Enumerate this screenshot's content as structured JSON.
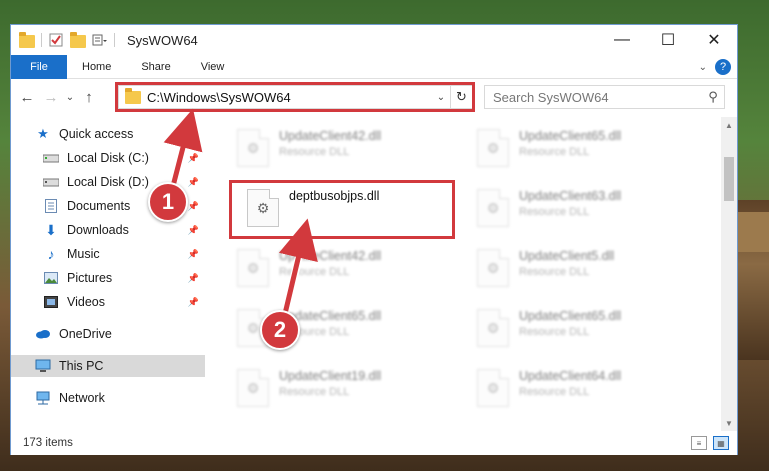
{
  "window": {
    "title": "SysWOW64"
  },
  "window_controls": {
    "minimize": "—",
    "maximize": "☐",
    "close": "✕"
  },
  "ribbon": {
    "tabs": [
      "File",
      "Home",
      "Share",
      "View"
    ],
    "help": "?"
  },
  "nav": {
    "back": "←",
    "forward": "→",
    "recent": "⌄",
    "up": "↑"
  },
  "address": {
    "path": "C:\\Windows\\SysWOW64",
    "dropdown": "⌄",
    "refresh": "↻"
  },
  "search": {
    "placeholder": "Search SysWOW64"
  },
  "sidebar": {
    "items": [
      {
        "label": "Quick access",
        "icon": "star-icon"
      },
      {
        "label": "Local Disk (C:)",
        "icon": "drive-icon",
        "pinned": true
      },
      {
        "label": "Local Disk (D:)",
        "icon": "drive-icon",
        "pinned": true
      },
      {
        "label": "Documents",
        "icon": "document-icon",
        "pinned": true
      },
      {
        "label": "Downloads",
        "icon": "download-icon",
        "pinned": true
      },
      {
        "label": "Music",
        "icon": "music-icon",
        "pinned": true
      },
      {
        "label": "Pictures",
        "icon": "picture-icon",
        "pinned": true
      },
      {
        "label": "Videos",
        "icon": "video-icon",
        "pinned": true
      },
      {
        "label": "OneDrive",
        "icon": "cloud-icon"
      },
      {
        "label": "This PC",
        "icon": "computer-icon",
        "selected": true
      },
      {
        "label": "Network",
        "icon": "network-icon"
      }
    ]
  },
  "files": [
    {
      "name": "UpdateClient42.dll",
      "type": "Resource DLL",
      "blurred": true
    },
    {
      "name": "UpdateClient65.dll",
      "type": "Resource DLL",
      "blurred": true
    },
    {
      "name": "deptbusobjps.dll",
      "type": "",
      "blurred": false
    },
    {
      "name": "UpdateClient63.dll",
      "type": "Resource DLL",
      "blurred": true
    },
    {
      "name": "UpdateClient42.dll",
      "type": "Resource DLL",
      "blurred": true
    },
    {
      "name": "UpdateClient5.dll",
      "type": "Resource DLL",
      "blurred": true
    },
    {
      "name": "UpdateClient65.dll",
      "type": "Resource DLL",
      "blurred": true
    },
    {
      "name": "UpdateClient65.dll",
      "type": "Resource DLL",
      "blurred": true
    },
    {
      "name": "UpdateClient19.dll",
      "type": "Resource DLL",
      "blurred": true
    },
    {
      "name": "UpdateClient64.dll",
      "type": "Resource DLL",
      "blurred": true
    }
  ],
  "status": {
    "item_count": "173 items"
  },
  "annotations": {
    "step1": "1",
    "step2": "2",
    "color": "#d2393d"
  }
}
